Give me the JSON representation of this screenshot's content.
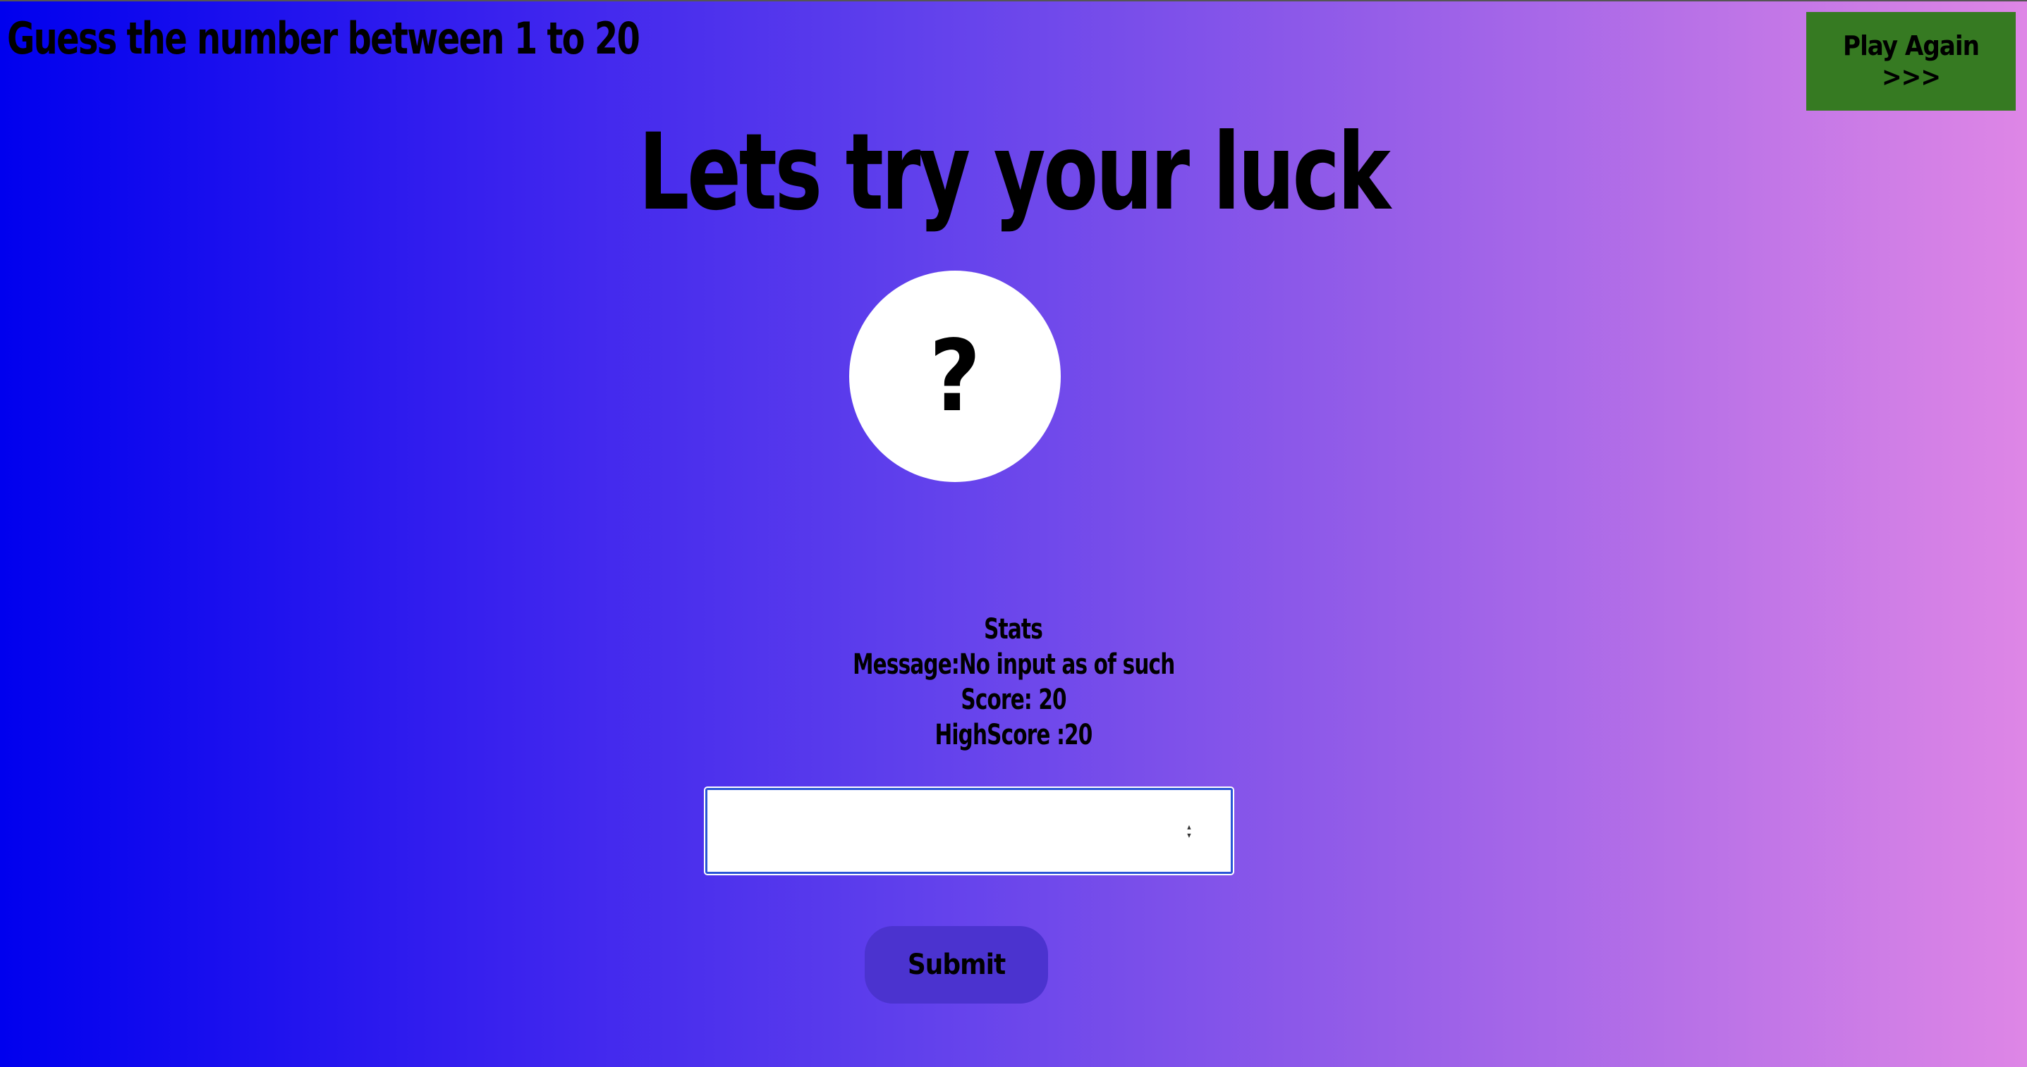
{
  "page": {
    "title": "Guess the number between 1 to 20",
    "headline": "Lets try your luck",
    "secret_display": "?"
  },
  "controls": {
    "play_again_label": "Play Again >>>",
    "submit_label": "Submit",
    "guess_input_value": ""
  },
  "stats": {
    "heading": "Stats",
    "message": "Message:No input as of such",
    "score": "Score: 20",
    "highscore": "HighScore :20"
  },
  "colors": {
    "gradient_start": "#0000ee",
    "gradient_end": "#de86e6",
    "play_again_bg": "#367a22",
    "submit_bg": "#4b33cf",
    "circle_bg": "#ffffff"
  }
}
